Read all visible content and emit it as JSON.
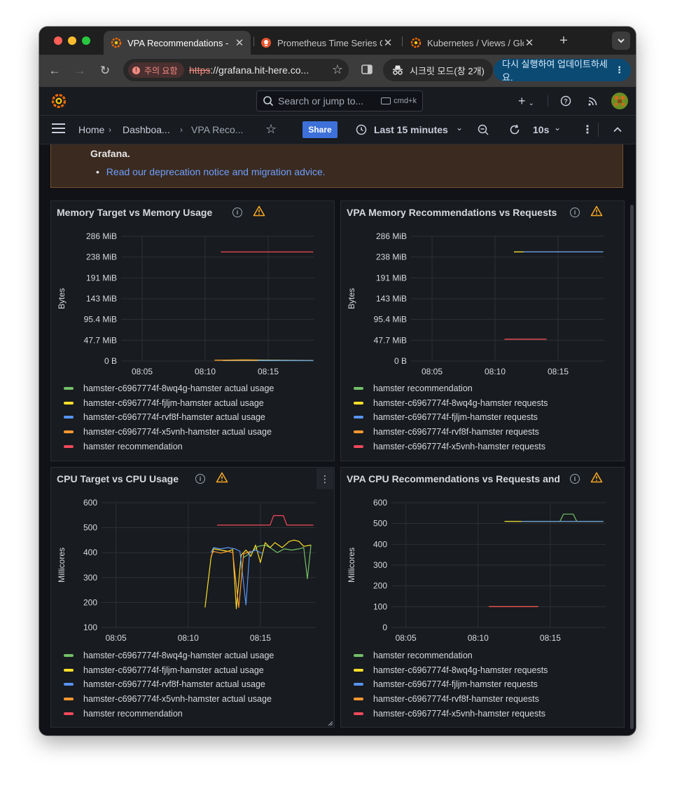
{
  "browser": {
    "tabs": [
      {
        "label": "VPA Recommendations - ",
        "active": true,
        "favicon": "grafana-icon"
      },
      {
        "label": "Prometheus Time Series C",
        "active": false,
        "favicon": "prometheus-icon"
      },
      {
        "label": "Kubernetes / Views / Glob",
        "active": false,
        "favicon": "grafana-icon"
      }
    ],
    "security_warning": "주의 요함",
    "url_scheme": "https",
    "url_rest": "://grafana.hit-here.co...",
    "incognito_label": "시크릿 모드(창 2개)",
    "update_label": "다시 실행하여 업데이트하세요."
  },
  "grafana": {
    "search_placeholder": "Search or jump to...",
    "search_shortcut": "cmd+k",
    "breadcrumbs": [
      "Home",
      "Dashboa...",
      "VPA Reco..."
    ],
    "share_label": "Share",
    "time_range": "Last 15 minutes",
    "refresh_interval": "10s"
  },
  "notice": {
    "text": "Grafana.",
    "link": "Read our deprecation notice and migration advice."
  },
  "chart_data": [
    {
      "type": "line",
      "title": "Memory Target vs Memory Usage",
      "ylabel": "Bytes",
      "ytick_labels": [
        "0 B",
        "47.7 MiB",
        "95.4 MiB",
        "143 MiB",
        "191 MiB",
        "238 MiB",
        "286 MiB"
      ],
      "xtick_labels": [
        "08:05",
        "08:10",
        "08:15"
      ],
      "x_range": [
        "08:03:20",
        "08:18:40"
      ],
      "y_range_mib": [
        0,
        286
      ],
      "series": [
        {
          "name": "hamster-c6967774f-8wq4g-hamster actual usage",
          "color": "#73bf69",
          "points": [
            [
              "08:11:25",
              1.2
            ],
            [
              "08:18:35",
              1.2
            ]
          ]
        },
        {
          "name": "hamster-c6967774f-fjljm-hamster actual usage",
          "color": "#fade2a",
          "points": [
            [
              "08:10:45",
              2
            ],
            [
              "08:13:00",
              2.5
            ],
            [
              "08:18:35",
              1.5
            ]
          ]
        },
        {
          "name": "hamster-c6967774f-rvf8f-hamster actual usage",
          "color": "#5794f2",
          "points": [
            [
              "08:11:30",
              1.5
            ],
            [
              "08:18:35",
              1.3
            ]
          ]
        },
        {
          "name": "hamster-c6967774f-x5vnh-hamster actual usage",
          "color": "#ff9830",
          "points": [
            [
              "08:10:45",
              1.8
            ],
            [
              "08:14:10",
              1.8
            ]
          ]
        },
        {
          "name": "hamster recommendation",
          "color": "#f2495c",
          "points": [
            [
              "08:11:15",
              250
            ],
            [
              "08:18:35",
              250
            ]
          ]
        }
      ]
    },
    {
      "type": "line",
      "title": "VPA Memory Recommendations vs Requests",
      "ylabel": "Bytes",
      "ytick_labels": [
        "0 B",
        "47.7 MiB",
        "95.4 MiB",
        "143 MiB",
        "191 MiB",
        "238 MiB",
        "286 MiB"
      ],
      "xtick_labels": [
        "08:05",
        "08:10",
        "08:15"
      ],
      "x_range": [
        "08:03:20",
        "08:18:40"
      ],
      "y_range_mib": [
        0,
        286
      ],
      "series": [
        {
          "name": "hamster recommendation",
          "color": "#73bf69",
          "points": [
            [
              "08:11:30",
              250
            ],
            [
              "08:18:35",
              250
            ]
          ]
        },
        {
          "name": "hamster-c6967774f-8wq4g-hamster requests",
          "color": "#fade2a",
          "points": [
            [
              "08:11:30",
              250
            ],
            [
              "08:18:35",
              250
            ]
          ]
        },
        {
          "name": "hamster-c6967774f-fjljm-hamster requests",
          "color": "#5794f2",
          "points": [
            [
              "08:12:15",
              250
            ],
            [
              "08:18:35",
              250
            ]
          ]
        },
        {
          "name": "hamster-c6967774f-rvf8f-hamster requests",
          "color": "#ff9830",
          "points": [
            [
              "08:10:45",
              50
            ],
            [
              "08:14:05",
              50
            ]
          ]
        },
        {
          "name": "hamster-c6967774f-x5vnh-hamster requests",
          "color": "#f2495c",
          "points": [
            [
              "08:10:45",
              50
            ],
            [
              "08:14:05",
              50
            ]
          ]
        }
      ]
    },
    {
      "type": "line",
      "title": "CPU Target vs CPU Usage",
      "ylabel": "Millicores",
      "yticks": [
        100,
        200,
        300,
        400,
        500,
        600
      ],
      "xtick_labels": [
        "08:05",
        "08:10",
        "08:15"
      ],
      "x_range": [
        "08:04:00",
        "08:18:50"
      ],
      "ylim": [
        100,
        600
      ],
      "series": [
        {
          "name": "hamster-c6967774f-8wq4g-hamster actual usage",
          "color": "#73bf69",
          "points": [
            [
              "08:13:50",
              380
            ],
            [
              "08:14:20",
              400
            ],
            [
              "08:14:50",
              425
            ],
            [
              "08:15:20",
              430
            ],
            [
              "08:15:40",
              420
            ],
            [
              "08:16:10",
              400
            ],
            [
              "08:16:40",
              415
            ],
            [
              "08:17:10",
              410
            ],
            [
              "08:17:40",
              415
            ],
            [
              "08:18:00",
              420
            ],
            [
              "08:18:15",
              295
            ],
            [
              "08:18:30",
              430
            ]
          ]
        },
        {
          "name": "hamster-c6967774f-fjljm-hamster actual usage",
          "color": "#fade2a",
          "points": [
            [
              "08:11:10",
              180
            ],
            [
              "08:11:35",
              380
            ],
            [
              "08:11:45",
              415
            ],
            [
              "08:12:15",
              410
            ],
            [
              "08:12:45",
              405
            ],
            [
              "08:13:05",
              412
            ],
            [
              "08:13:20",
              175
            ],
            [
              "08:13:40",
              390
            ],
            [
              "08:14:00",
              410
            ],
            [
              "08:14:20",
              385
            ],
            [
              "08:14:40",
              430
            ],
            [
              "08:15:00",
              360
            ],
            [
              "08:15:20",
              440
            ],
            [
              "08:15:40",
              420
            ],
            [
              "08:16:00",
              440
            ],
            [
              "08:16:30",
              420
            ],
            [
              "08:17:00",
              445
            ],
            [
              "08:17:20",
              450
            ],
            [
              "08:17:40",
              445
            ],
            [
              "08:18:00",
              425
            ],
            [
              "08:18:30",
              430
            ]
          ]
        },
        {
          "name": "hamster-c6967774f-rvf8f-hamster actual usage",
          "color": "#5794f2",
          "points": [
            [
              "08:11:35",
              400
            ],
            [
              "08:11:45",
              420
            ],
            [
              "08:12:15",
              415
            ],
            [
              "08:12:45",
              420
            ],
            [
              "08:13:15",
              415
            ],
            [
              "08:13:35",
              405
            ],
            [
              "08:14:00",
              190
            ],
            [
              "08:14:15",
              400
            ],
            [
              "08:14:40",
              410
            ],
            [
              "08:15:10",
              395
            ]
          ]
        },
        {
          "name": "hamster-c6967774f-x5vnh-hamster actual usage",
          "color": "#ff9830",
          "points": [
            [
              "08:11:35",
              385
            ],
            [
              "08:11:45",
              405
            ],
            [
              "08:12:15",
              398
            ],
            [
              "08:12:45",
              405
            ],
            [
              "08:13:05",
              400
            ],
            [
              "08:13:30",
              180
            ],
            [
              "08:13:50",
              395
            ],
            [
              "08:14:20",
              405
            ]
          ]
        },
        {
          "name": "hamster recommendation",
          "color": "#f2495c",
          "points": [
            [
              "08:12:00",
              510
            ],
            [
              "08:14:50",
              510
            ],
            [
              "08:15:40",
              510
            ],
            [
              "08:15:55",
              548
            ],
            [
              "08:16:35",
              548
            ],
            [
              "08:16:50",
              510
            ],
            [
              "08:18:40",
              510
            ]
          ]
        }
      ]
    },
    {
      "type": "line",
      "title": "VPA CPU Recommendations vs Requests and",
      "ylabel": "Millicores",
      "yticks": [
        0,
        100,
        200,
        300,
        400,
        500,
        600
      ],
      "xtick_labels": [
        "08:05",
        "08:10",
        "08:15"
      ],
      "x_range": [
        "08:04:00",
        "08:18:50"
      ],
      "ylim": [
        0,
        600
      ],
      "series": [
        {
          "name": "hamster recommendation",
          "color": "#73bf69",
          "points": [
            [
              "08:11:50",
              510
            ],
            [
              "08:15:40",
              510
            ],
            [
              "08:15:55",
              545
            ],
            [
              "08:16:35",
              545
            ],
            [
              "08:16:50",
              510
            ],
            [
              "08:18:40",
              510
            ]
          ]
        },
        {
          "name": "hamster-c6967774f-8wq4g-hamster requests",
          "color": "#fade2a",
          "points": [
            [
              "08:11:50",
              510
            ],
            [
              "08:18:40",
              510
            ]
          ]
        },
        {
          "name": "hamster-c6967774f-fjljm-hamster requests",
          "color": "#5794f2",
          "points": [
            [
              "08:13:00",
              510
            ],
            [
              "08:18:40",
              510
            ]
          ]
        },
        {
          "name": "hamster-c6967774f-rvf8f-hamster requests",
          "color": "#ff9830",
          "points": [
            [
              "08:10:45",
              100
            ],
            [
              "08:14:10",
              100
            ]
          ]
        },
        {
          "name": "hamster-c6967774f-x5vnh-hamster requests",
          "color": "#f2495c",
          "points": [
            [
              "08:10:45",
              100
            ],
            [
              "08:14:10",
              100
            ]
          ]
        }
      ]
    }
  ]
}
